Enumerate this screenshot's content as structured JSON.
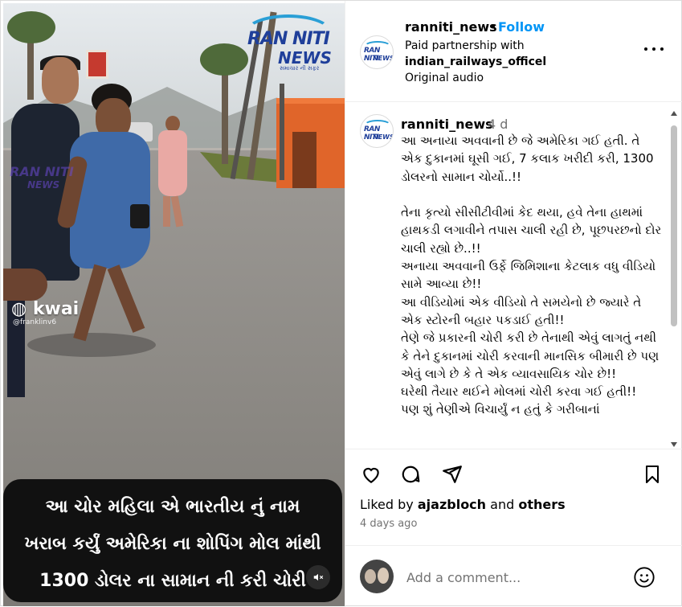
{
  "media": {
    "watermark": {
      "line1": "RAN NITI",
      "line2": "NEWS",
      "tagline": "સમાચાર ની સફર"
    },
    "kwai": {
      "label": "kwai",
      "handle": "@franklinv6"
    },
    "caption": [
      "આ ચોર મહિલા એ ભારતીય નું નામ",
      "ખરાબ કર્યું અમેરિકા ના શોપિંગ મોલ માંથી",
      "1300 ડોલર ના સામાન ની કરી ચોરી"
    ],
    "mute_icon": "speaker-muted-icon"
  },
  "header": {
    "username": "ranniti_news",
    "separator": "•",
    "follow_label": "Follow",
    "paid_partnership": "Paid partnership with",
    "partner": "indian_railways_officel",
    "audio": "Original audio",
    "more_icon": "more-options-icon",
    "avatar_logo": {
      "line1": "RAN NITI",
      "line2": "NEWS"
    }
  },
  "comment": {
    "username": "ranniti_news",
    "time": "4 d",
    "text": "આ અનાયા અવવાની છે જે અમેરિકા ગઈ હતી. તે એક દુકાનમાં ઘૂસી ગઈ, 7 કલાક ખરીદી કરી, 1300 ડોલરનો સામાન ચોર્યો..!!\n\nતેના કૃત્યો સીસીટીવીમાં કેદ થયા, હવે તેના હાથમાં હાથકડી લગાવીને તપાસ ચાલી રહી છે, પૂછપરછનો દોર ચાલી રહ્યો છે..!!\nઅનાયા અવવાની ઉર્ફે જિમિશાના કેટલાક વધુ વીડિયો સામે આવ્યા છે!!\nઆ વીડિયોમાં એક વીડિયો તે સમયેનો છે જ્યારે તે એક સ્ટોરની બહાર પકડાઈ હતી!!\nતેણે જે પ્રકારની ચોરી કરી છે તેનાથી એવું લાગતું નથી કે તેને દુકાનમાં ચોરી કરવાની માનસિક બીમારી છે પણ એવું લાગે છે કે તે એક વ્યાવસાયિક ચોર છે!!\nઘરેથી તૈયાર થઈને મોલમાં ચોરી કરવા ગઈ હતી!!\nપણ શું તેણીએ વિચાર્યું ન હતું કે ગરીબાનાં"
  },
  "actions": {
    "like_icon": "heart-icon",
    "comment_icon": "comment-icon",
    "share_icon": "share-icon",
    "save_icon": "bookmark-icon",
    "liked_prefix": "Liked by",
    "liked_user": "ajazbloch",
    "liked_and": "and",
    "liked_others": "others",
    "posted": "4 days ago"
  },
  "add_comment": {
    "placeholder": "Add a comment...",
    "emoji_icon": "emoji-icon"
  },
  "colors": {
    "follow_blue": "#0095f6",
    "muted_text": "#737373",
    "border": "#dbdbdb",
    "logo_blue": "#1f3f9a",
    "caption_bg": "#111111"
  }
}
